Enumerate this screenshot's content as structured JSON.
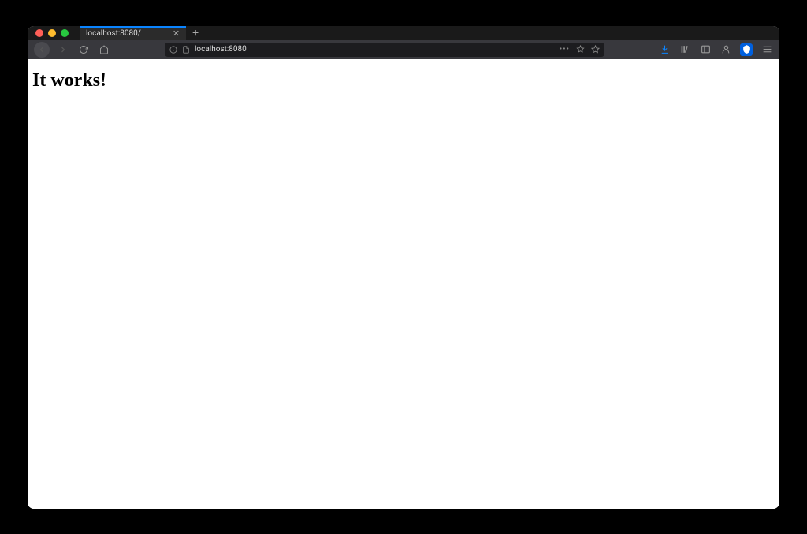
{
  "tab": {
    "title": "localhost:8080/"
  },
  "url": {
    "text": "localhost:8080"
  },
  "page": {
    "heading": "It works!"
  },
  "icons": {
    "close": "close-icon",
    "plus": "plus-icon",
    "back": "back-icon",
    "forward": "forward-icon",
    "reload": "reload-icon",
    "home": "home-icon",
    "info": "info-icon",
    "page": "page-icon",
    "more": "more-icon",
    "reader": "reader-icon",
    "star": "star-icon",
    "download": "download-icon",
    "library": "library-icon",
    "sidebar": "sidebar-icon",
    "account": "account-icon",
    "shield": "shield-icon",
    "menu": "menu-icon"
  }
}
